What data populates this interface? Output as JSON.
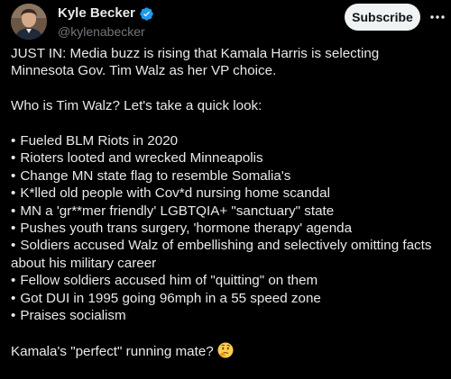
{
  "author": {
    "display_name": "Kyle Becker",
    "handle": "@kylenabecker",
    "verified": true
  },
  "actions": {
    "subscribe_label": "Subscribe",
    "more_icon": "ellipsis-icon"
  },
  "tweet": {
    "intro": "JUST IN: Media buzz is rising that Kamala Harris is selecting Minnesota Gov. Tim Walz as her VP choice.",
    "question": "Who is Tim Walz? Let's take a quick look:",
    "bullet_char": "•",
    "bullets": [
      "Fueled BLM Riots in 2020",
      "Rioters looted and wrecked Minneapolis",
      "Change MN state flag to resemble Somalia's",
      "K*lled old people with Cov*d nursing home scandal",
      "MN a 'gr**mer friendly' LGBTQIA+ \"sanctuary\" state",
      "Pushes youth trans surgery, 'hormone therapy' agenda",
      "Soldiers accused Walz of embellishing and selectively omitting facts about his military career",
      "Fellow soldiers accused him of \"quitting\" on them",
      "Got DUI in 1995 going 96mph in a 55 speed zone",
      "Praises socialism"
    ],
    "closing": "Kamala's \"perfect\" running mate?",
    "closing_emoji": "thinking-face-icon"
  },
  "colors": {
    "background": "#000000",
    "text": "#e7e9ea",
    "secondary_text": "#71767b",
    "verified_blue": "#1d9bf0",
    "button_bg": "#eff3f4"
  }
}
